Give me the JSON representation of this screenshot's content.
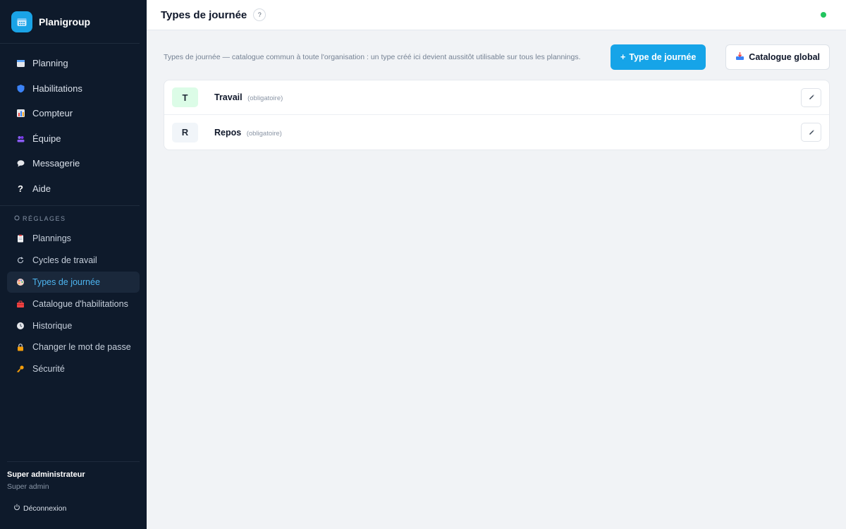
{
  "brand": {
    "name": "Planigroup",
    "icon": "calendar-icon"
  },
  "nav_main": [
    {
      "label": "Planning",
      "icon": "calendar-icon",
      "color": "#60a5fa"
    },
    {
      "label": "Habilitations",
      "icon": "shield-icon",
      "color": "#3b82f6"
    },
    {
      "label": "Compteur",
      "icon": "bar-chart-icon",
      "color": "#f59e0b"
    },
    {
      "label": "Équipe",
      "icon": "people-icon",
      "color": "#8b5cf6"
    },
    {
      "label": "Messagerie",
      "icon": "speech-bubble-icon",
      "color": "#e5e7eb"
    },
    {
      "label": "Aide",
      "icon": "question-icon",
      "color": "#ffffff"
    }
  ],
  "settings": {
    "label": "RÉGLAGES",
    "items": [
      {
        "label": "Plannings",
        "icon": "clipboard-icon",
        "active": false
      },
      {
        "label": "Cycles de travail",
        "icon": "refresh-icon",
        "active": false
      },
      {
        "label": "Types de journée",
        "icon": "palette-icon",
        "active": true
      },
      {
        "label": "Catalogue d'habilitations",
        "icon": "toolbox-icon",
        "active": false
      },
      {
        "label": "Historique",
        "icon": "clock-icon",
        "active": false
      },
      {
        "label": "Changer le mot de passe",
        "icon": "lock-icon",
        "active": false
      },
      {
        "label": "Sécurité",
        "icon": "key-icon",
        "active": false
      }
    ]
  },
  "user": {
    "name": "Super administrateur",
    "role": "Super admin",
    "logout_label": "Déconnexion"
  },
  "header": {
    "title": "Types de journée",
    "help": "?",
    "status_color": "#22c55e"
  },
  "main": {
    "description": "Types de journée — catalogue commun à toute l'organisation : un type créé ici devient aussitôt utilisable sur tous les plannings.",
    "add_button": "Type de journée",
    "add_button_prefix": "+",
    "catalog_button": "Catalogue global"
  },
  "day_types": [
    {
      "code": "T",
      "name": "Travail",
      "tag": "(obligatoire)",
      "color": "#dcfce7"
    },
    {
      "code": "R",
      "name": "Repos",
      "tag": "(obligatoire)",
      "color": "#f1f5f9"
    }
  ],
  "colors": {
    "accent": "#16a4e8",
    "sidebar": "#0e1a2b"
  }
}
